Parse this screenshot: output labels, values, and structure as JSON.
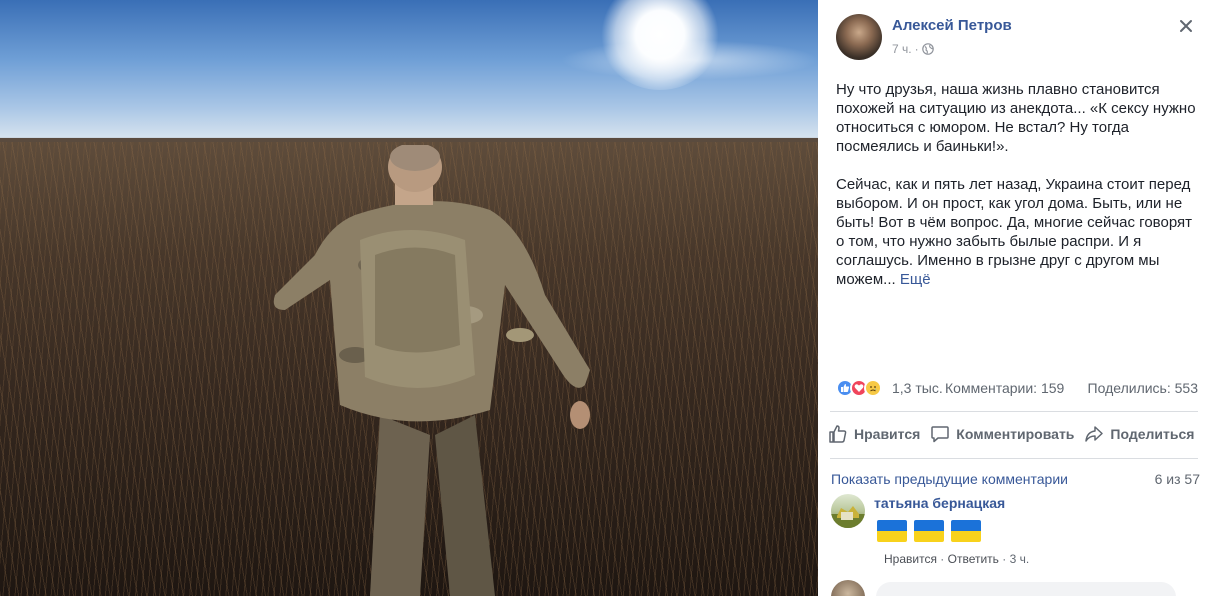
{
  "post": {
    "author": "Алексей Петров",
    "time": "7 ч.",
    "privacy_icon": "globe-icon",
    "paragraph1": "Ну что друзья, наша жизнь плавно становится похожей на ситуацию из анекдота... «К сексу нужно относиться с юмором. Не встал? Ну тогда посмеялись и баиньки!».",
    "paragraph2": "Сейчас, как и пять лет назад, Украина стоит перед выбором. И он прост, как угол дома. Быть, или не быть! Вот в чём вопрос. Да, многие сейчас говорят о том, что нужно забыть былые распри. И я соглашусь. Именно в грызне друг с другом мы можем...",
    "more": "Ещё"
  },
  "stats": {
    "reactions": "1,3 тыс.",
    "comments": "Комментарии: 159",
    "shares": "Поделились: 553"
  },
  "actions": {
    "like": "Нравится",
    "comment": "Комментировать",
    "share": "Поделиться"
  },
  "comments": {
    "show_previous": "Показать предыдущие комментарии",
    "count": "6 из 57",
    "items": [
      {
        "author": "татьяна бернацкая",
        "content_icons": [
          "ukraine-flag-icon",
          "ukraine-flag-icon",
          "ukraine-flag-icon"
        ],
        "like": "Нравится",
        "reply": "Ответить",
        "time": "3 ч.",
        "separator": "·"
      }
    ]
  },
  "colors": {
    "link": "#385898",
    "text": "#1d2129",
    "secondary": "#606770",
    "flag_blue": "#1b72d9",
    "flag_yellow": "#f8d21c"
  }
}
